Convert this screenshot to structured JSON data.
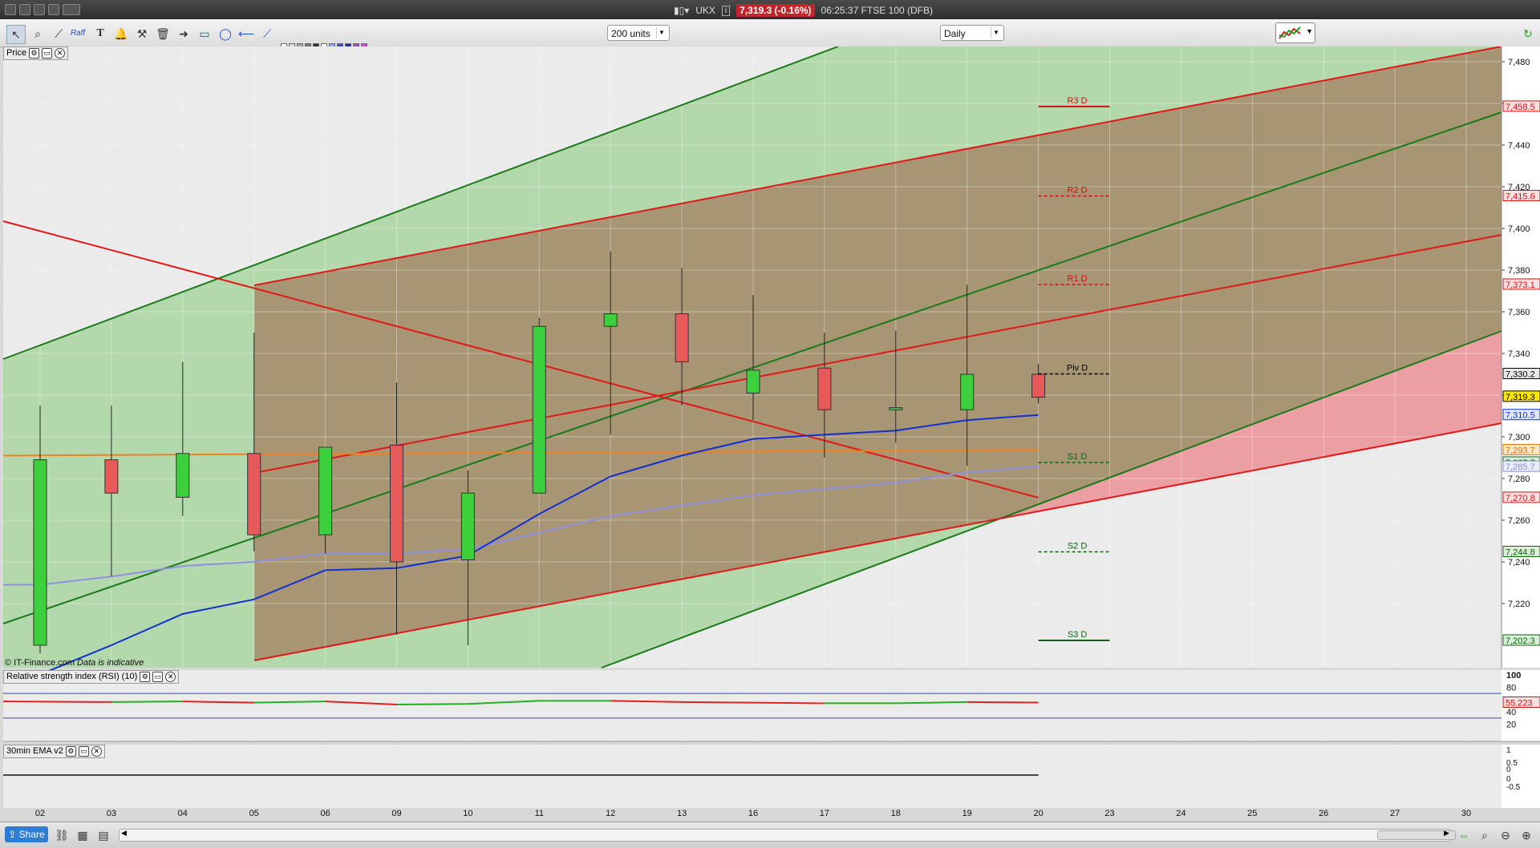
{
  "window": {
    "instrument": "UKX",
    "price_badge": "7,319.3 (-0.16%)",
    "time_label": "06:25:37 FTSE 100 (DFB)"
  },
  "toolbar": {
    "units_select": "200 units",
    "interval_select": "Daily",
    "raff_label": "Raff"
  },
  "price_panel": {
    "label": "Price",
    "copyright": "© IT-Finance.com",
    "indicative": "Data is indicative"
  },
  "rsi_panel": {
    "label": "Relative strength index (RSI) (10)",
    "ticks": [
      "100",
      "80",
      "60",
      "40",
      "20"
    ],
    "value_badge": "55.223"
  },
  "ema_panel": {
    "label": "30min EMA v2",
    "ticks": [
      "1",
      "0.5",
      "0",
      "0",
      "-0.5"
    ]
  },
  "price_axis": {
    "ticks": [
      7220,
      7240,
      7260,
      7280,
      7300,
      7320,
      7340,
      7360,
      7380,
      7400,
      7420,
      7440,
      7460,
      7480
    ],
    "tick_labels": [
      "7,220",
      "7,240",
      "7,260",
      "7,280",
      "7,300",
      "7,320",
      "7,340",
      "7,360",
      "7,380",
      "7,400",
      "7,420",
      "7,440",
      "7,460",
      "7,480"
    ]
  },
  "price_badges": [
    {
      "label": "7,458.5",
      "value": 7458.5,
      "color": "#d01010",
      "bg": "#ffe0e0"
    },
    {
      "label": "7,415.6",
      "value": 7415.6,
      "color": "#d01010",
      "bg": "#ffe0e0"
    },
    {
      "label": "7,373.1",
      "value": 7373.1,
      "color": "#d01010",
      "bg": "#ffe0e0"
    },
    {
      "label": "7,330.2",
      "value": 7330.2,
      "color": "#000000",
      "bg": "#e8e8e8"
    },
    {
      "label": "7,319.3",
      "value": 7319.3,
      "color": "#000000",
      "bg": "#f7e600"
    },
    {
      "label": "7,310.5",
      "value": 7310.5,
      "color": "#1030d0",
      "bg": "#e0e6ff"
    },
    {
      "label": "7,293.7",
      "value": 7293.7,
      "color": "#e07000",
      "bg": "#ffe8cc"
    },
    {
      "label": "7,287.7",
      "value": 7287.7,
      "color": "#106010",
      "bg": "#d8f0d8"
    },
    {
      "label": "7,285.7",
      "value": 7285.7,
      "color": "#8888dd",
      "bg": "#ececff"
    },
    {
      "label": "7,270.8",
      "value": 7270.8,
      "color": "#d01010",
      "bg": "#ffe0e0"
    },
    {
      "label": "7,244.8",
      "value": 7244.8,
      "color": "#106010",
      "bg": "#d8f0d8"
    },
    {
      "label": "7,202.3",
      "value": 7202.3,
      "color": "#106010",
      "bg": "#d8f0d8"
    }
  ],
  "pivots": [
    {
      "label": "R3 D",
      "value": 7458.5,
      "color": "#d01010",
      "dash": false
    },
    {
      "label": "R2 D",
      "value": 7415.6,
      "color": "#d01010",
      "dash": true
    },
    {
      "label": "R1 D",
      "value": 7373.1,
      "color": "#d01010",
      "dash": true
    },
    {
      "label": "Piv D",
      "value": 7330.2,
      "color": "#000000",
      "dash": true
    },
    {
      "label": "S1 D",
      "value": 7287.7,
      "color": "#106010",
      "dash": true
    },
    {
      "label": "S2 D",
      "value": 7244.8,
      "color": "#106010",
      "dash": true
    },
    {
      "label": "S3 D",
      "value": 7202.3,
      "color": "#106010",
      "dash": false
    }
  ],
  "chart_data": {
    "type": "candlestick",
    "x_labels": [
      "02",
      "03",
      "04",
      "05",
      "06",
      "09",
      "10",
      "11",
      "12",
      "13",
      "16",
      "17",
      "18",
      "19",
      "20",
      "23",
      "24",
      "25",
      "26",
      "27",
      "30"
    ],
    "ylim": [
      7195,
      7485
    ],
    "candles": [
      {
        "x": "02",
        "open": 7200,
        "high": 7315,
        "low": 7196,
        "close": 7289
      },
      {
        "x": "03",
        "open": 7289,
        "high": 7315,
        "low": 7233,
        "close": 7273
      },
      {
        "x": "04",
        "open": 7271,
        "high": 7336,
        "low": 7262,
        "close": 7292
      },
      {
        "x": "05",
        "open": 7292,
        "high": 7350,
        "low": 7245,
        "close": 7253
      },
      {
        "x": "06",
        "open": 7253,
        "high": 7295,
        "low": 7244,
        "close": 7295
      },
      {
        "x": "09",
        "open": 7296,
        "high": 7326,
        "low": 7205,
        "close": 7240
      },
      {
        "x": "10",
        "open": 7241,
        "high": 7284,
        "low": 7200,
        "close": 7273
      },
      {
        "x": "11",
        "open": 7273,
        "high": 7357,
        "low": 7273,
        "close": 7353
      },
      {
        "x": "12",
        "open": 7353,
        "high": 7389,
        "low": 7301,
        "close": 7359
      },
      {
        "x": "13",
        "open": 7359,
        "high": 7381,
        "low": 7315,
        "close": 7336
      },
      {
        "x": "16",
        "open": 7321,
        "high": 7368,
        "low": 7308,
        "close": 7332
      },
      {
        "x": "17",
        "open": 7333,
        "high": 7350,
        "low": 7290,
        "close": 7313
      },
      {
        "x": "18",
        "open": 7313,
        "high": 7351,
        "low": 7297,
        "close": 7314
      },
      {
        "x": "19",
        "open": 7313,
        "high": 7373,
        "low": 7286,
        "close": 7330
      },
      {
        "x": "20",
        "open": 7330,
        "high": 7335,
        "low": 7316,
        "close": 7319
      }
    ],
    "ma_blue": [
      7186,
      7200,
      7215,
      7222,
      7236,
      7237,
      7243,
      7263,
      7281,
      7291,
      7299,
      7301,
      7303,
      7308,
      7310.5
    ],
    "ma_purple": [
      7229,
      7233,
      7238,
      7240,
      7244,
      7244,
      7246,
      7254,
      7262,
      7267,
      7272,
      7275,
      7278,
      7283,
      7285.7
    ],
    "ma_orange_value": 7293.7,
    "rsi": [
      57,
      56,
      57,
      55,
      57,
      52,
      53,
      58,
      58,
      56,
      55,
      54,
      54,
      56,
      55.223
    ]
  }
}
